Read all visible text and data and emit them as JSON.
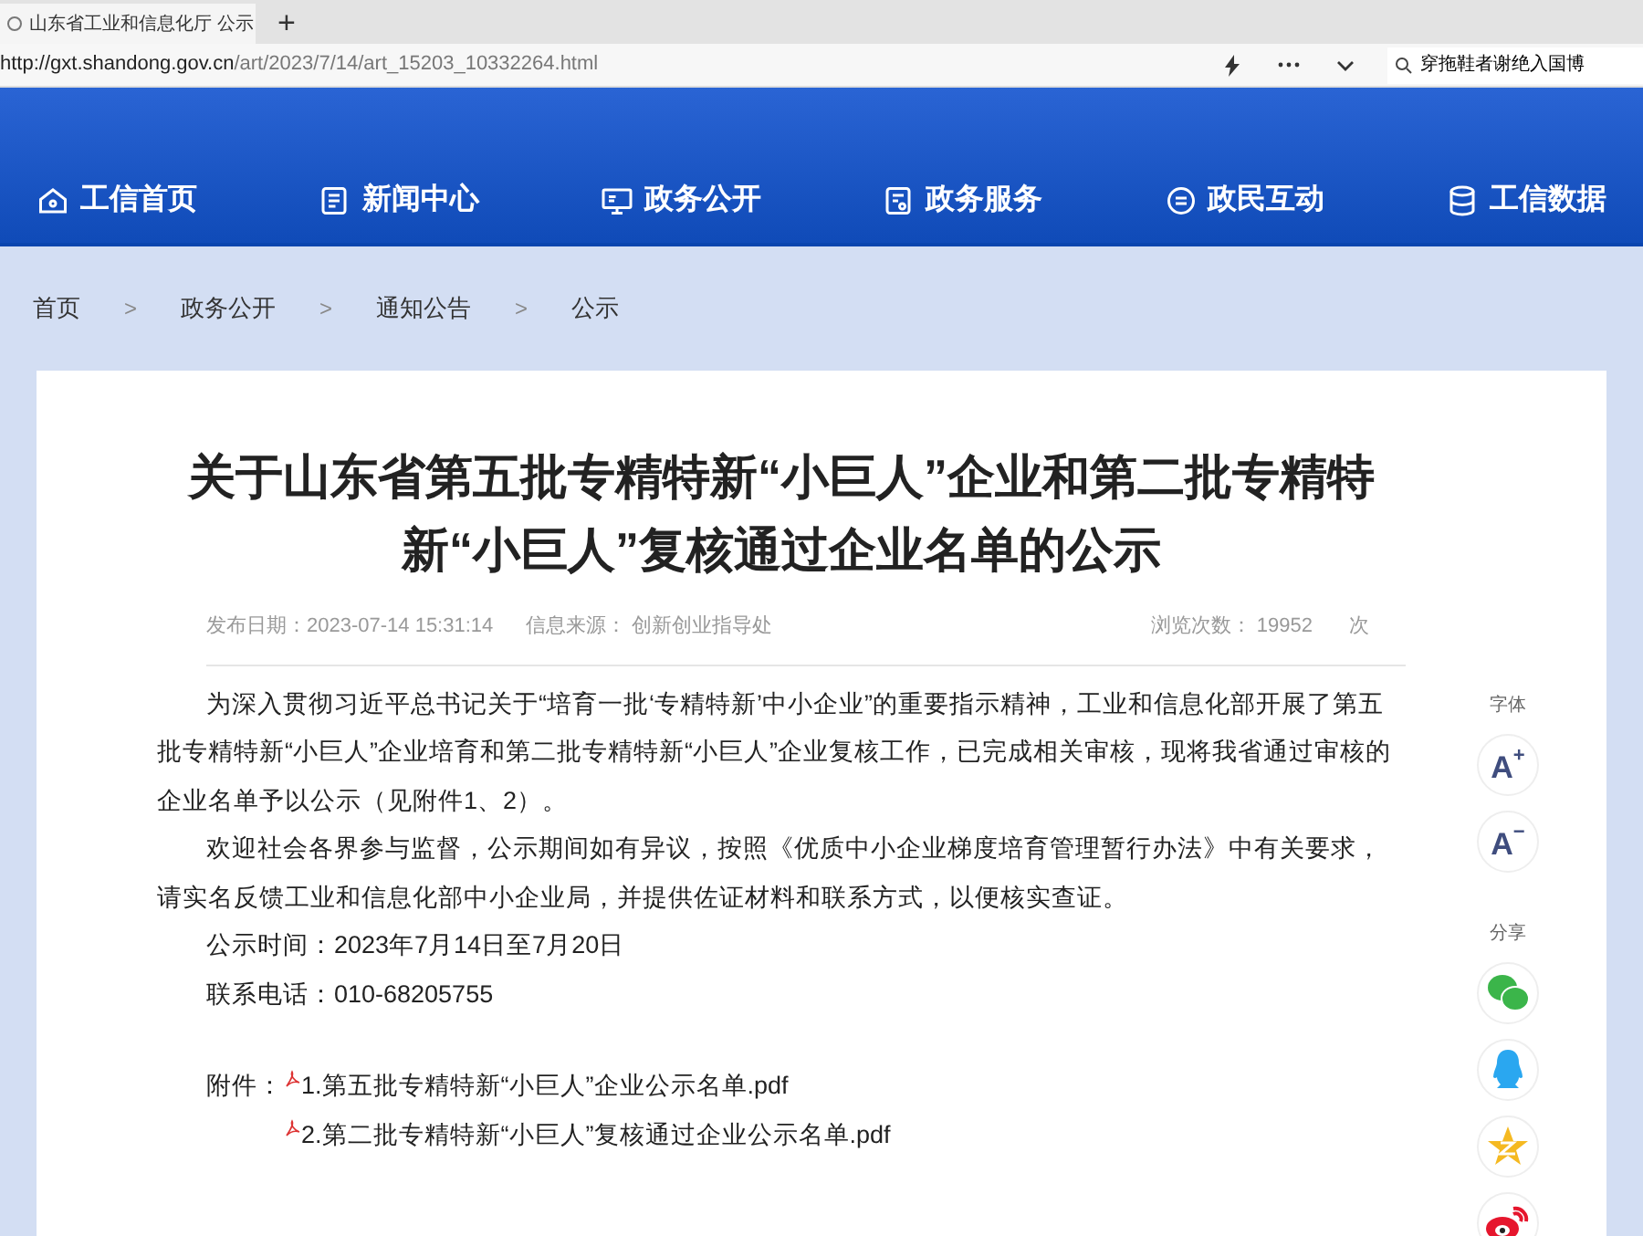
{
  "browser": {
    "tab_title": "山东省工业和信息化厅 公示",
    "new_tab": "+",
    "url_host": "http://gxt.shandong.gov.cn",
    "url_path": "/art/2023/7/14/art_15203_10332264.html",
    "search_text": "穿拖鞋者谢绝入国博"
  },
  "nav": [
    {
      "label": "工信首页"
    },
    {
      "label": "新闻中心"
    },
    {
      "label": "政务公开"
    },
    {
      "label": "政务服务"
    },
    {
      "label": "政民互动"
    },
    {
      "label": "工信数据"
    }
  ],
  "breadcrumb": {
    "items": [
      "首页",
      "政务公开",
      "通知公告",
      "公示"
    ],
    "separator": ">"
  },
  "article": {
    "title": "关于山东省第五批专精特新“小巨人”企业和第二批专精特新“小巨人”复核通过企业名单的公示",
    "meta": {
      "date_label": "发布日期：",
      "date": "2023-07-14 15:31:14",
      "source_label": "信息来源：",
      "source": "创新创业指导处",
      "views_label": "浏览次数：",
      "views": "19952",
      "views_unit": "次"
    },
    "paragraphs": [
      {
        "kind": "indent",
        "text": "为深入贯彻习近平总书记关于“培育一批‘专精特新’中小企业”的重要指示精神，工业和信息化部开展了第五批专精特新“小巨人”企业培育和第二批专精特新“小巨人”企业复核工作，已完成相关审核，现将我省通过审核的企业名单予以公示（见附件1、2）。"
      },
      {
        "kind": "indent",
        "text": "欢迎社会各界参与监督，公示期间如有异议，按照《优质中小企业梯度培育管理暂行办法》中有关要求，请实名反馈工业和信息化部中小企业局，并提供佐证材料和联系方式，以便核实查证。"
      },
      {
        "kind": "line",
        "text": "公示时间：2023年7月14日至7月20日"
      },
      {
        "kind": "line",
        "text": "联系电话：010-68205755"
      }
    ],
    "attachments_label": "附件：",
    "attachments": [
      "1.第五批专精特新“小巨人”企业公示名单.pdf",
      "2.第二批专精特新“小巨人”复核通过企业公示名单.pdf"
    ]
  },
  "side_tools": {
    "font_label": "字体",
    "font_buttons": [
      {
        "letter": "A",
        "sign": "+"
      },
      {
        "letter": "A",
        "sign": "−"
      }
    ],
    "share_label": "分享",
    "share": [
      {
        "kind": "wechat"
      },
      {
        "kind": "qq"
      },
      {
        "kind": "qzone"
      },
      {
        "kind": "weibo"
      }
    ]
  }
}
